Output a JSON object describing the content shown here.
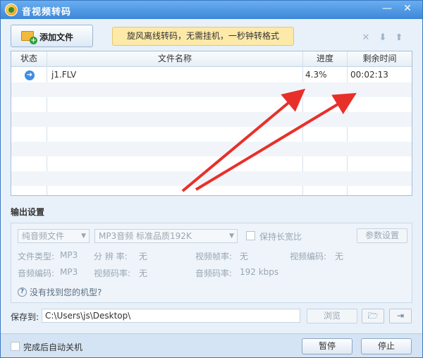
{
  "window": {
    "title": "音视频转码"
  },
  "toolbar": {
    "add_file_label": "添加文件",
    "promo_text": "旋风离线转码，无需挂机，一秒钟转格式",
    "icons": [
      "close-x-icon",
      "move-down-icon",
      "move-up-icon"
    ]
  },
  "table": {
    "headers": {
      "status": "状态",
      "filename": "文件名称",
      "progress": "进度",
      "remaining": "剩余时间"
    },
    "rows": [
      {
        "status_icon": "arrow-right-icon",
        "filename": "j1.FLV",
        "progress": "4.3%",
        "remaining": "00:02:13"
      }
    ]
  },
  "output": {
    "section_title": "输出设置",
    "format_type": "纯音频文件",
    "preset": "MP3音频 标准品质192K",
    "keep_ratio_label": "保持长宽比",
    "params_button": "参数设置",
    "info": {
      "file_type_label": "文件类型:",
      "file_type": "MP3",
      "resolution_label": "分 辨 率:",
      "resolution": "无",
      "video_fps_label": "视频帧率:",
      "video_fps": "无",
      "video_codec_label": "视频编码:",
      "video_codec": "无",
      "audio_codec_label": "音频编码:",
      "audio_codec": "MP3",
      "video_bitrate_label": "视频码率:",
      "video_bitrate": "无",
      "audio_bitrate_label": "音频码率:",
      "audio_bitrate": "192 kbps"
    },
    "help_link": "没有找到您的机型?"
  },
  "save": {
    "label": "保存到:",
    "path": "C:\\Users\\js\\Desktop\\",
    "browse_label": "浏览"
  },
  "bottom": {
    "auto_shutdown_label": "完成后自动关机",
    "pause_label": "暂停",
    "stop_label": "停止"
  },
  "colors": {
    "accent": "#3d87d8",
    "promo_bg": "#fde9a8",
    "annotation_arrow": "#e8302a"
  }
}
